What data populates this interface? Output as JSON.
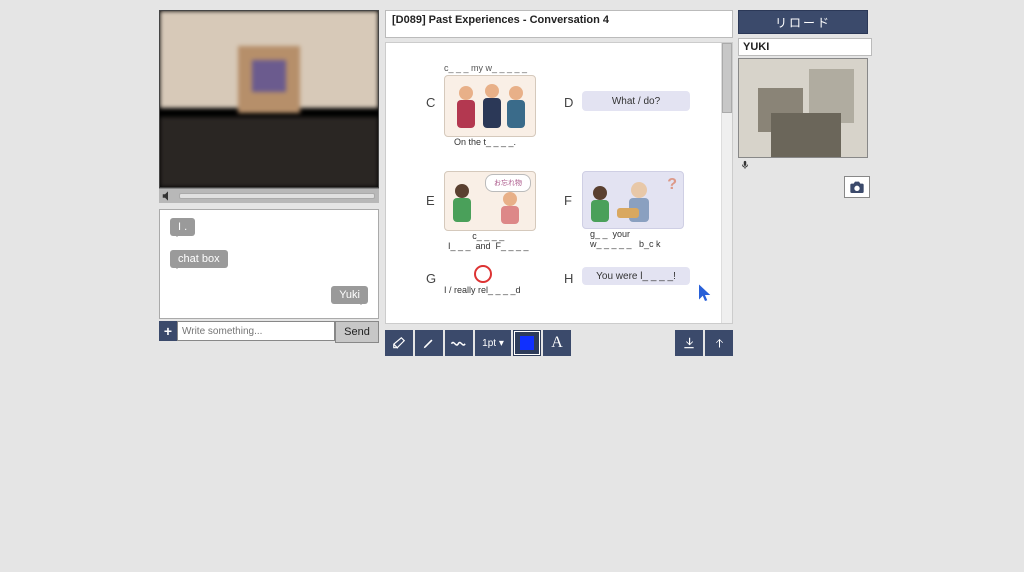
{
  "topic_title": "[D089] Past Experiences - Conversation 4",
  "chat": {
    "msg1": "I   .",
    "msg2": "chat box",
    "msg3": "Yuki",
    "placeholder": "Write something...",
    "send_label": "Send"
  },
  "toolbar": {
    "stroke_label": "1pt ▾",
    "text_label": "A"
  },
  "right": {
    "reload_label": "リロード",
    "username": "YUKI"
  },
  "slide": {
    "C": {
      "letter": "C",
      "caption_top": "c_ _ _  my  w_ _ _ _ _",
      "caption_bottom": "On the t_ _ _ _."
    },
    "D": {
      "letter": "D",
      "hint": "What / do?"
    },
    "E": {
      "letter": "E",
      "bubble": "お忘れ物",
      "caption": "c_ _ _ _\nI_ _ _  and  F_ _ _ _"
    },
    "F": {
      "letter": "F",
      "caption": "g_ _  your\nw_ _ _ _ _   b_c k"
    },
    "G": {
      "letter": "G",
      "caption": "I / really rel_ _ _ _d"
    },
    "H": {
      "letter": "H",
      "hint": "You were l_ _ _ _!"
    }
  }
}
